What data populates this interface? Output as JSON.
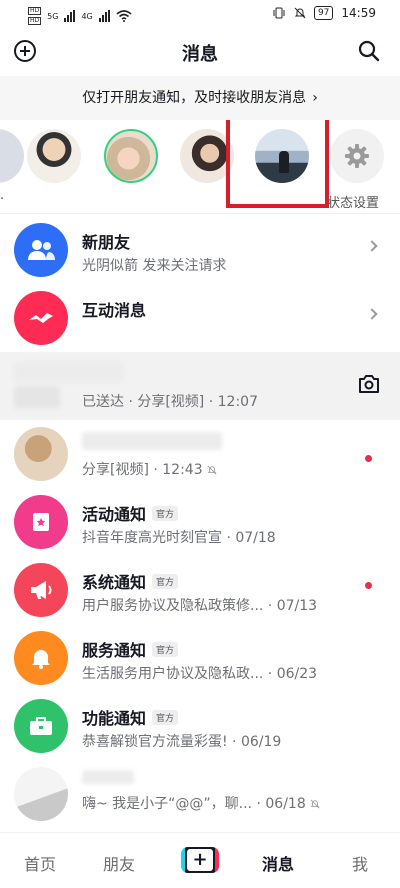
{
  "status_bar": {
    "sim_labels": [
      "HD",
      "HD"
    ],
    "network": [
      "5G",
      "4G"
    ],
    "battery": "97",
    "time": "14:59"
  },
  "header": {
    "title": "消息"
  },
  "notice": {
    "text": "仅打开朋友通知，及时接收朋友消息"
  },
  "friends_row": {
    "status_settings_label": "状态设置",
    "highlight_color": "#d81e2a"
  },
  "messages": [
    {
      "name": "新朋友",
      "preview": "光阴似箭 发来关注请求",
      "time": ""
    },
    {
      "name": "互动消息",
      "preview": "",
      "time": ""
    },
    {
      "name": "",
      "preview": "已送达 · 分享[视频] · 12:07",
      "time": ""
    },
    {
      "name": "",
      "preview": "分享[视频] · 12:43",
      "time": ""
    },
    {
      "name": "活动通知",
      "badge": "官方",
      "preview": "抖音年度高光时刻官宣 · 07/18",
      "time": ""
    },
    {
      "name": "系统通知",
      "badge": "官方",
      "preview": "用户服务协议及隐私政策修... · 07/13",
      "time": ""
    },
    {
      "name": "服务通知",
      "badge": "官方",
      "preview": "生活服务用户协议及隐私政... · 06/23",
      "time": ""
    },
    {
      "name": "功能通知",
      "badge": "官方",
      "preview": "恭喜解锁官方流量彩蛋! · 06/19",
      "time": ""
    },
    {
      "name": "",
      "preview": "嗨~ 我是小子“@@”，聊... · 06/18",
      "time": ""
    }
  ],
  "colors": {
    "accent_red": "#e2304a",
    "new_friends_blue": "#2e6df5",
    "interaction_pink": "#fe2c55",
    "activity_pink": "#f03c8a",
    "system_red": "#f5455a",
    "service_orange": "#ff8a1f",
    "feature_green": "#2fc26b"
  },
  "bottom_nav": {
    "home": "首页",
    "friends": "朋友",
    "plus": "+",
    "messages": "消息",
    "me": "我"
  }
}
